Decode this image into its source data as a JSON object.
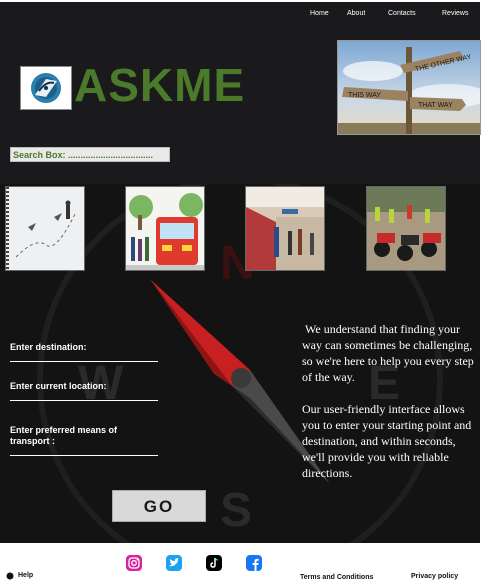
{
  "nav": {
    "items": [
      {
        "label": "Home"
      },
      {
        "label": "About"
      },
      {
        "label": "Contacts"
      },
      {
        "label": "Reviews"
      }
    ]
  },
  "brand": {
    "name": "ASKME"
  },
  "signpost": {
    "signs": [
      "THE OTHER WAY",
      "THIS WAY",
      "THAT WAY"
    ]
  },
  "search": {
    "label": "Search Box: .................................."
  },
  "form": {
    "destination_label": "Enter destination:",
    "current_label": "Enter current location:",
    "transport_label": "Enter preferred means of transport :",
    "go_label": "GO"
  },
  "compass": {
    "letters": {
      "north": "N",
      "west": "W",
      "east": "E",
      "south": "S"
    }
  },
  "info": {
    "paragraph_1": "We understand that finding your way can sometimes be challenging, so we're here to help you every step of the way.",
    "paragraph_2": "Our user-friendly interface allows you to enter your starting point and destination, and within seconds, we'll provide you with reliable directions."
  },
  "footer": {
    "help_label": "Help",
    "terms_label": "Terms and Conditions",
    "privacy_label": "Privacy policy"
  },
  "colors": {
    "header_bg": "#1a1a1d",
    "band_bg": "#131313",
    "brand_green": "#4a7a2a",
    "compass_red": "#c82020",
    "instagram": "#d6249f",
    "twitter": "#1da1f2",
    "tiktok": "#000000",
    "facebook": "#1877f2"
  }
}
